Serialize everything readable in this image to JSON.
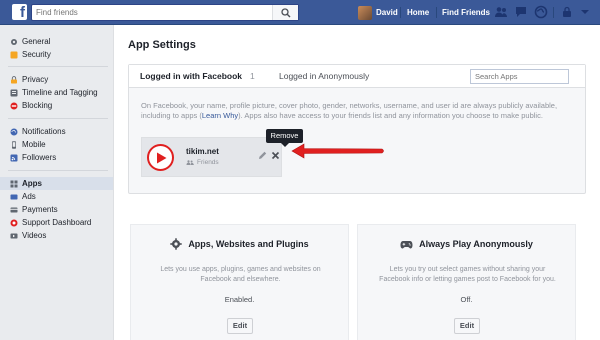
{
  "topbar": {
    "search_placeholder": "Find friends",
    "user_name": "David",
    "home": "Home",
    "find_friends": "Find Friends",
    "brand_color": "#3b5998"
  },
  "sidebar": {
    "items": [
      {
        "label": "General",
        "icon": "gear-icon"
      },
      {
        "label": "Security",
        "icon": "lock-icon"
      },
      {
        "label": "Privacy",
        "icon": "privacy-lock-icon"
      },
      {
        "label": "Timeline and Tagging",
        "icon": "timeline-icon"
      },
      {
        "label": "Blocking",
        "icon": "block-icon"
      },
      {
        "label": "Notifications",
        "icon": "globe-icon"
      },
      {
        "label": "Mobile",
        "icon": "mobile-icon"
      },
      {
        "label": "Followers",
        "icon": "rss-icon"
      },
      {
        "label": "Apps",
        "icon": "apps-icon"
      },
      {
        "label": "Ads",
        "icon": "ads-icon"
      },
      {
        "label": "Payments",
        "icon": "payments-icon"
      },
      {
        "label": "Support Dashboard",
        "icon": "support-icon"
      },
      {
        "label": "Videos",
        "icon": "video-icon"
      }
    ],
    "active": "Apps"
  },
  "main": {
    "title": "App Settings",
    "tabs": [
      {
        "label": "Logged in with Facebook",
        "count": "1"
      },
      {
        "label": "Logged in Anonymously"
      }
    ],
    "search_apps_placeholder": "Search Apps",
    "info_pre": "On Facebook, your name, profile picture, cover photo, gender, networks, username, and user id are always publicly available, including to apps (",
    "info_link": "Learn Why",
    "info_post": "). Apps also have access to your friends list and any information you choose to make public.",
    "app": {
      "name": "tikim.net",
      "audience": "Friends"
    },
    "tooltip": "Remove"
  },
  "settings_cards": [
    {
      "title": "Apps, Websites and Plugins",
      "description": "Lets you use apps, plugins, games and websites on Facebook and elsewhere.",
      "status": "Enabled.",
      "button": "Edit"
    },
    {
      "title": "Always Play Anonymously",
      "description": "Lets you try out select games without sharing your Facebook info or letting games post to Facebook for you.",
      "status": "Off.",
      "button": "Edit"
    }
  ],
  "colors": {
    "arrow": "#e02020",
    "link": "#365899"
  }
}
